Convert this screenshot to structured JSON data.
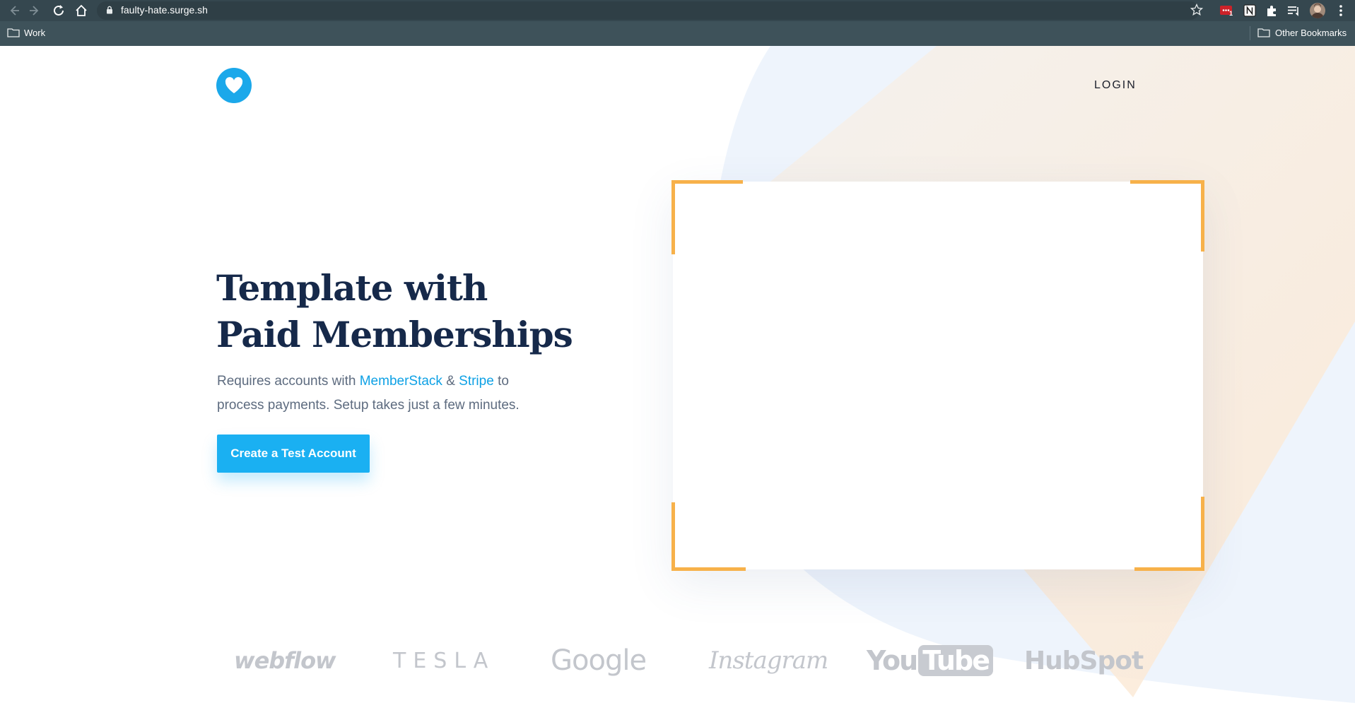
{
  "browser": {
    "url": "faulty-hate.surge.sh",
    "extension_badge": "1",
    "bookmarks": {
      "left_folder": "Work",
      "right_folder": "Other Bookmarks"
    }
  },
  "header": {
    "login_label": "LOGIN"
  },
  "hero": {
    "headline_line1": "Template with",
    "headline_line2": "Paid Memberships",
    "subtext_prefix": "Requires accounts with ",
    "link_memberstack": "MemberStack",
    "subtext_amp": " & ",
    "link_stripe": "Stripe",
    "subtext_suffix": " to process payments. Setup takes just a few minutes.",
    "cta_label": "Create a Test Account"
  },
  "brands": {
    "webflow": "webflow",
    "tesla": "TESLA",
    "google": "Google",
    "instagram": "Instagram",
    "youtube_you": "You",
    "youtube_tube": "Tube",
    "hubspot": "HubSpot"
  },
  "colors": {
    "brand_blue": "#1ab0f2",
    "accent_orange": "#f7b14a",
    "headline": "#16294a",
    "chrome_bg": "#35474f"
  }
}
